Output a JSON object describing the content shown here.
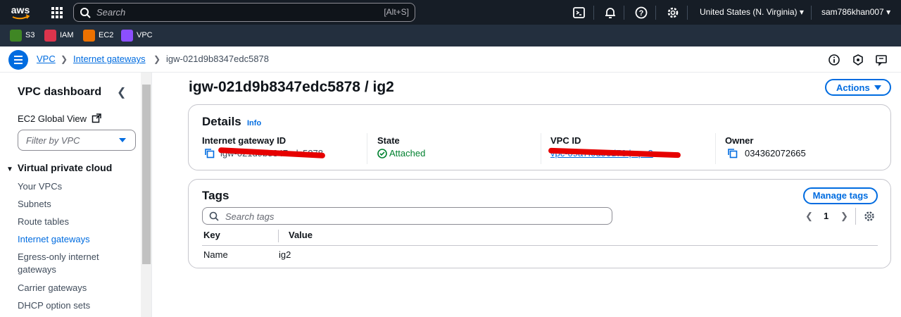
{
  "topnav": {
    "logo_text": "aws",
    "search_placeholder": "Search",
    "search_shortcut": "[Alt+S]",
    "icons": [
      "cloudshell-icon",
      "bell-icon",
      "help-icon",
      "gear-icon"
    ],
    "region": "United States (N. Virginia) ▾",
    "account": "sam786khan007 ▾"
  },
  "favorites": [
    {
      "label": "S3",
      "color": "#3f8624"
    },
    {
      "label": "IAM",
      "color": "#dd344c"
    },
    {
      "label": "EC2",
      "color": "#ed7100"
    },
    {
      "label": "VPC",
      "color": "#8c4fff"
    }
  ],
  "breadcrumb": {
    "items": [
      "VPC",
      "Internet gateways",
      "igw-021d9b8347edc5878"
    ]
  },
  "sidebar": {
    "title": "VPC dashboard",
    "global_view": "EC2 Global View",
    "filter_placeholder": "Filter by VPC",
    "section": "Virtual private cloud",
    "items": [
      "Your VPCs",
      "Subnets",
      "Route tables",
      "Internet gateways",
      "Egress-only internet gateways",
      "Carrier gateways",
      "DHCP option sets"
    ],
    "active_item": "Internet gateways"
  },
  "page": {
    "title": "igw-021d9b8347edc5878 / ig2",
    "actions_label": "Actions"
  },
  "details": {
    "title": "Details",
    "info": "Info",
    "fields": [
      {
        "label": "Internet gateway ID",
        "value": "igw-021d9b8347edc5878"
      },
      {
        "label": "State",
        "value": "Attached"
      },
      {
        "label": "VPC ID",
        "value": "vpc-09a7f0d56d76 | vpc3"
      },
      {
        "label": "Owner",
        "value": "034362072665"
      }
    ],
    "colors": {
      "attached": "#00802f",
      "link": "#006ce0",
      "redaction": "#e60000"
    }
  },
  "tags": {
    "title": "Tags",
    "manage_label": "Manage tags",
    "search_placeholder": "Search tags",
    "page_number": "1",
    "columns": [
      "Key",
      "Value"
    ],
    "rows": [
      {
        "key": "Name",
        "value": "ig2"
      }
    ]
  }
}
